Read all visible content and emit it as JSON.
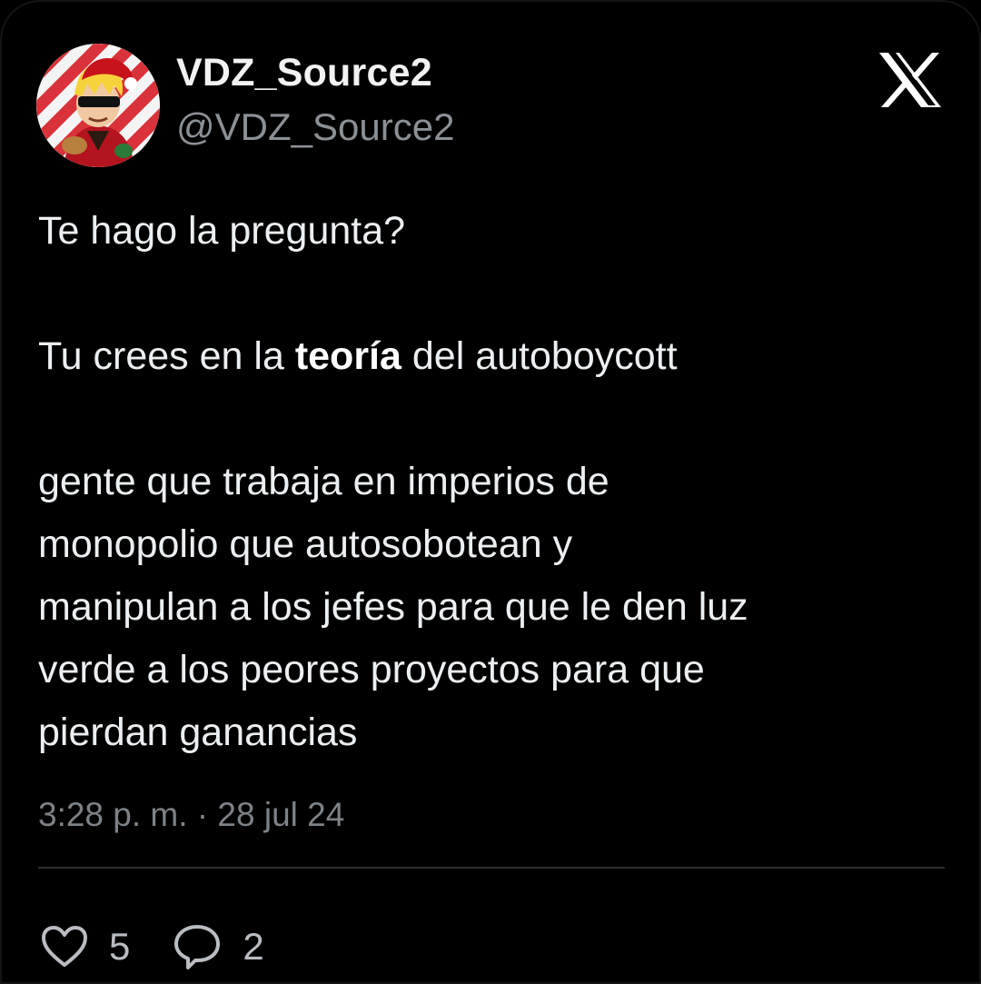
{
  "user": {
    "display_name": "VDZ_Source2",
    "handle": "@VDZ_Source2",
    "avatar_icon": "user-avatar"
  },
  "brand": {
    "logo_icon": "x-logo-icon"
  },
  "tweet": {
    "line_question": "Te hago la pregunta?",
    "line_theory_prefix": "Tu crees en la ",
    "line_theory_bold": "teoría",
    "line_theory_suffix": " del autoboycott",
    "paragraph_3": [
      "gente que trabaja en imperios de",
      "monopolio que autosobotean y",
      "manipulan a los jefes para que le den luz",
      "verde a los peores proyectos para que",
      "pierdan ganancias"
    ],
    "timestamp": "3:28 p. m. · 28 jul 24"
  },
  "actions": {
    "like_icon": "heart-icon",
    "like_count": "5",
    "reply_icon": "reply-bubble-icon",
    "reply_count": "2"
  },
  "colors": {
    "background": "#000000",
    "text": "#e7e9ea",
    "muted": "#8b9095",
    "divider": "#2b2e31"
  }
}
